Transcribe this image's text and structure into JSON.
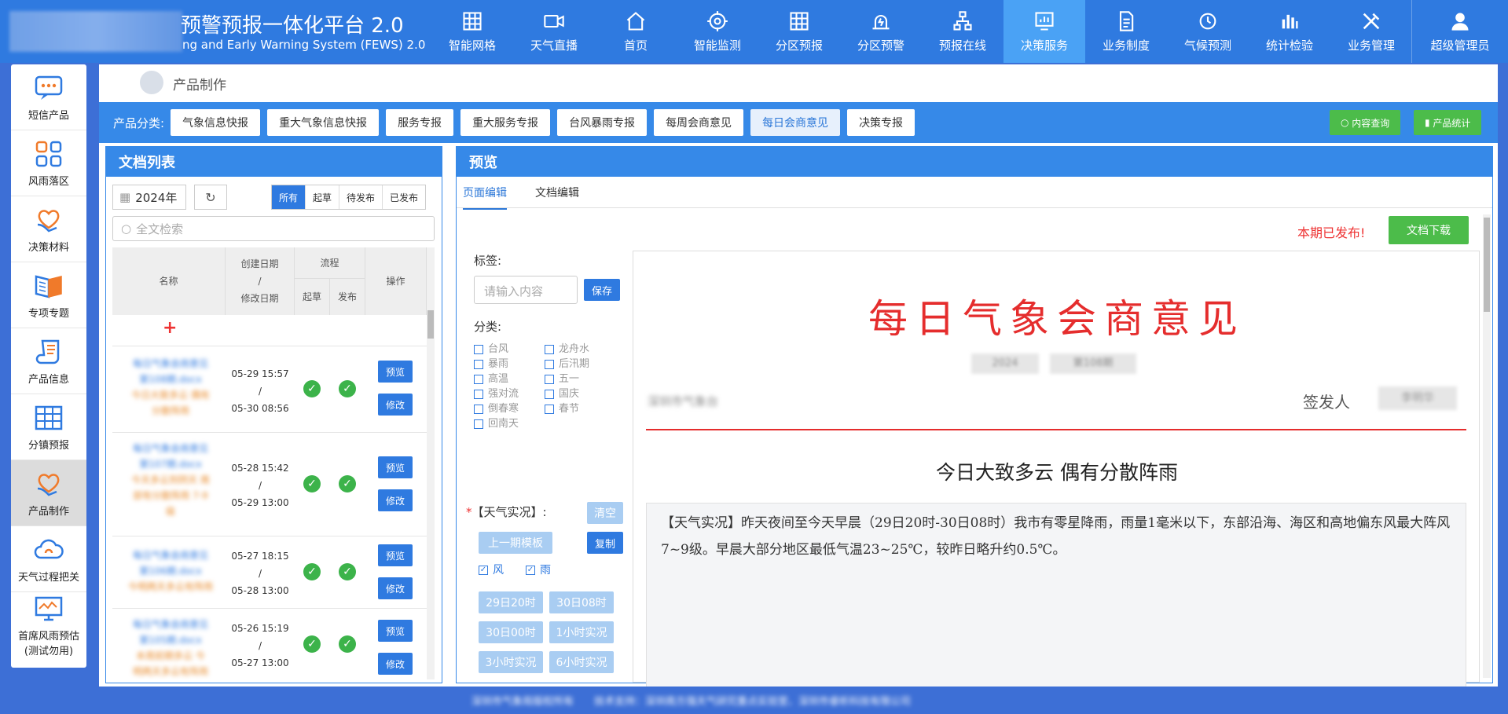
{
  "header": {
    "title": "预警预报一体化平台 2.0",
    "subtitle": "ng and Early Warning System (FEWS) 2.0",
    "nav": [
      {
        "label": "智能网格",
        "icon": "grid-icon"
      },
      {
        "label": "天气直播",
        "icon": "video-icon"
      },
      {
        "label": "首页",
        "icon": "home-icon"
      },
      {
        "label": "智能监测",
        "icon": "target-icon"
      },
      {
        "label": "分区预报",
        "icon": "grid-icon"
      },
      {
        "label": "分区预警",
        "icon": "alarm-icon"
      },
      {
        "label": "预报在线",
        "icon": "org-icon"
      },
      {
        "label": "决策服务",
        "icon": "chart-icon"
      },
      {
        "label": "业务制度",
        "icon": "document-icon"
      },
      {
        "label": "气候预测",
        "icon": "clock-icon"
      },
      {
        "label": "统计检验",
        "icon": "bar-icon"
      },
      {
        "label": "业务管理",
        "icon": "tools-icon"
      }
    ],
    "active_nav": "决策服务",
    "user": "超级管理员"
  },
  "sidebar": {
    "items": [
      {
        "label": "短信产品",
        "icon": "message-icon"
      },
      {
        "label": "风雨落区",
        "icon": "layout-icon"
      },
      {
        "label": "决策材料",
        "icon": "heart-hand-icon"
      },
      {
        "label": "专项专题",
        "icon": "book-icon"
      },
      {
        "label": "产品信息",
        "icon": "scroll-icon"
      },
      {
        "label": "分镇预报",
        "icon": "table-icon"
      },
      {
        "label": "产品制作",
        "icon": "heart-hand-icon"
      },
      {
        "label": "天气过程把关",
        "icon": "cloud-icon"
      },
      {
        "label": "首席风雨预估",
        "label2": "(测试勿用)",
        "icon": "monitor-icon"
      }
    ],
    "active": "产品制作"
  },
  "breadcrumb": "产品制作",
  "categories": {
    "label": "产品分类:",
    "items": [
      "气象信息快报",
      "重大气象信息快报",
      "服务专报",
      "重大服务专报",
      "台风暴雨专报",
      "每周会商意见",
      "每日会商意见",
      "决策专报"
    ],
    "active": "每日会商意见",
    "query_btn": "内容查询",
    "stats_btn": "产品统计"
  },
  "doclist": {
    "title": "文档列表",
    "year": "2024年",
    "filters": [
      "所有",
      "起草",
      "待发布",
      "已发布"
    ],
    "active_filter": "所有",
    "search_placeholder": "全文检索",
    "columns": {
      "name": "名称",
      "date": "创建日期",
      "date_sep": "/",
      "date2": "修改日期",
      "flow": "流程",
      "draft": "起草",
      "publish": "发布",
      "ops": "操作"
    },
    "add": "+",
    "rows": [
      {
        "n1": "每日气象会商意见",
        "n2": "第108期.docx",
        "n3": "今日大致多云 偶有",
        "n4": "分散阵雨",
        "created": "05-29 15:57",
        "sep": "/",
        "modified": "05-30 08:56"
      },
      {
        "n1": "每日气象会商意见",
        "n2": "第107期.docx",
        "n3": "今天多云到阴天 南",
        "n4": "部有分散阵雨 7-9",
        "n5": "级",
        "created": "05-28 15:42",
        "sep": "/",
        "modified": "05-29 13:00"
      },
      {
        "n1": "每日气象会商意见",
        "n2": "第106期.docx",
        "n3": "今明两天多云有阵雨",
        "created": "05-27 18:15",
        "sep": "/",
        "modified": "05-28 13:00"
      },
      {
        "n1": "每日气象会商意见",
        "n2": "第105期.docx",
        "n3": "本周前期多云 今",
        "n4": "明两天多云有阵雨",
        "created": "05-26 15:19",
        "sep": "/",
        "modified": "05-27 13:00"
      }
    ],
    "preview_btn": "预览",
    "edit_btn": "修改"
  },
  "preview": {
    "title": "预览",
    "tabs": [
      "页面编辑",
      "文档编辑"
    ],
    "active_tab": "页面编辑",
    "published": "本期已发布!",
    "download": "文档下载",
    "tag_label": "标签:",
    "tag_placeholder": "请输入内容",
    "save": "保存",
    "class_label": "分类:",
    "classes_left": [
      "台风",
      "暴雨",
      "高温",
      "强对流",
      "倒春寒",
      "回南天"
    ],
    "classes_right": [
      "龙舟水",
      "后汛期",
      "五一",
      "国庆",
      "春节"
    ],
    "weather_label": "【天气实况】:",
    "required": "*",
    "clear": "清空",
    "prev_template": "上一期模板",
    "copy": "复制",
    "wind": "风",
    "rain": "雨",
    "time_btns": [
      "29日20时",
      "30日08时",
      "30日00时",
      "1小时实况",
      "3小时实况",
      "6小时实况"
    ]
  },
  "document": {
    "heading": "每日气象会商意见",
    "year_box": "2024",
    "issue_box": "第108期",
    "org": "深圳市气象台",
    "signer_label": "签发人",
    "signer": "李明华",
    "headline": "今日大致多云 偶有分散阵雨",
    "body": "【天气实况】昨天夜间至今天早晨（29日20时-30日08时）我市有零星降雨，雨量1毫米以下，东部沿海、海区和高地偏东风最大阵风7~9级。早晨大部分地区最低气温23~25℃，较昨日略升约0.5℃。"
  },
  "footer": {
    "text": "深圳市气象局版权所有　　技术支持：深圳南方强天气研究重点实验室、深圳市睿析科技有限公司"
  }
}
